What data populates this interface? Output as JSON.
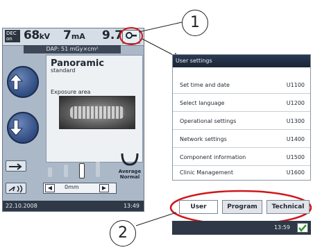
{
  "left": {
    "dec_badge": "DEC\non",
    "kv": "68",
    "kv_unit": "kV",
    "ma": "7",
    "ma_unit": "mA",
    "s": "9.7",
    "dap": "DAP: 51 mGy×cm²",
    "program_title": "Panoramic",
    "program_sub": "standard",
    "exposure_label": "Exposure area",
    "average_label": "Average",
    "normal_label": "Normal",
    "mm_value": "0mm",
    "date": "22.10.2008",
    "time": "13:49"
  },
  "callouts": {
    "one": "1",
    "two": "2"
  },
  "settings": {
    "header": "User settings",
    "items": [
      {
        "label": "Set time and date",
        "code": "U1100"
      },
      {
        "label": "Select language",
        "code": "U1200"
      },
      {
        "label": "Operational settings",
        "code": "U1300"
      },
      {
        "label": "Network settings",
        "code": "U1400"
      },
      {
        "label": "Component information",
        "code": "U1500"
      },
      {
        "label": "Clinic Management",
        "code": "U1600"
      }
    ]
  },
  "tabs": {
    "user": "User",
    "program": "Program",
    "technical": "Technical"
  },
  "bottom_time": "13:59",
  "colors": {
    "highlight_ellipse": "#d0161b",
    "accent_green": "#2e9b2e"
  }
}
